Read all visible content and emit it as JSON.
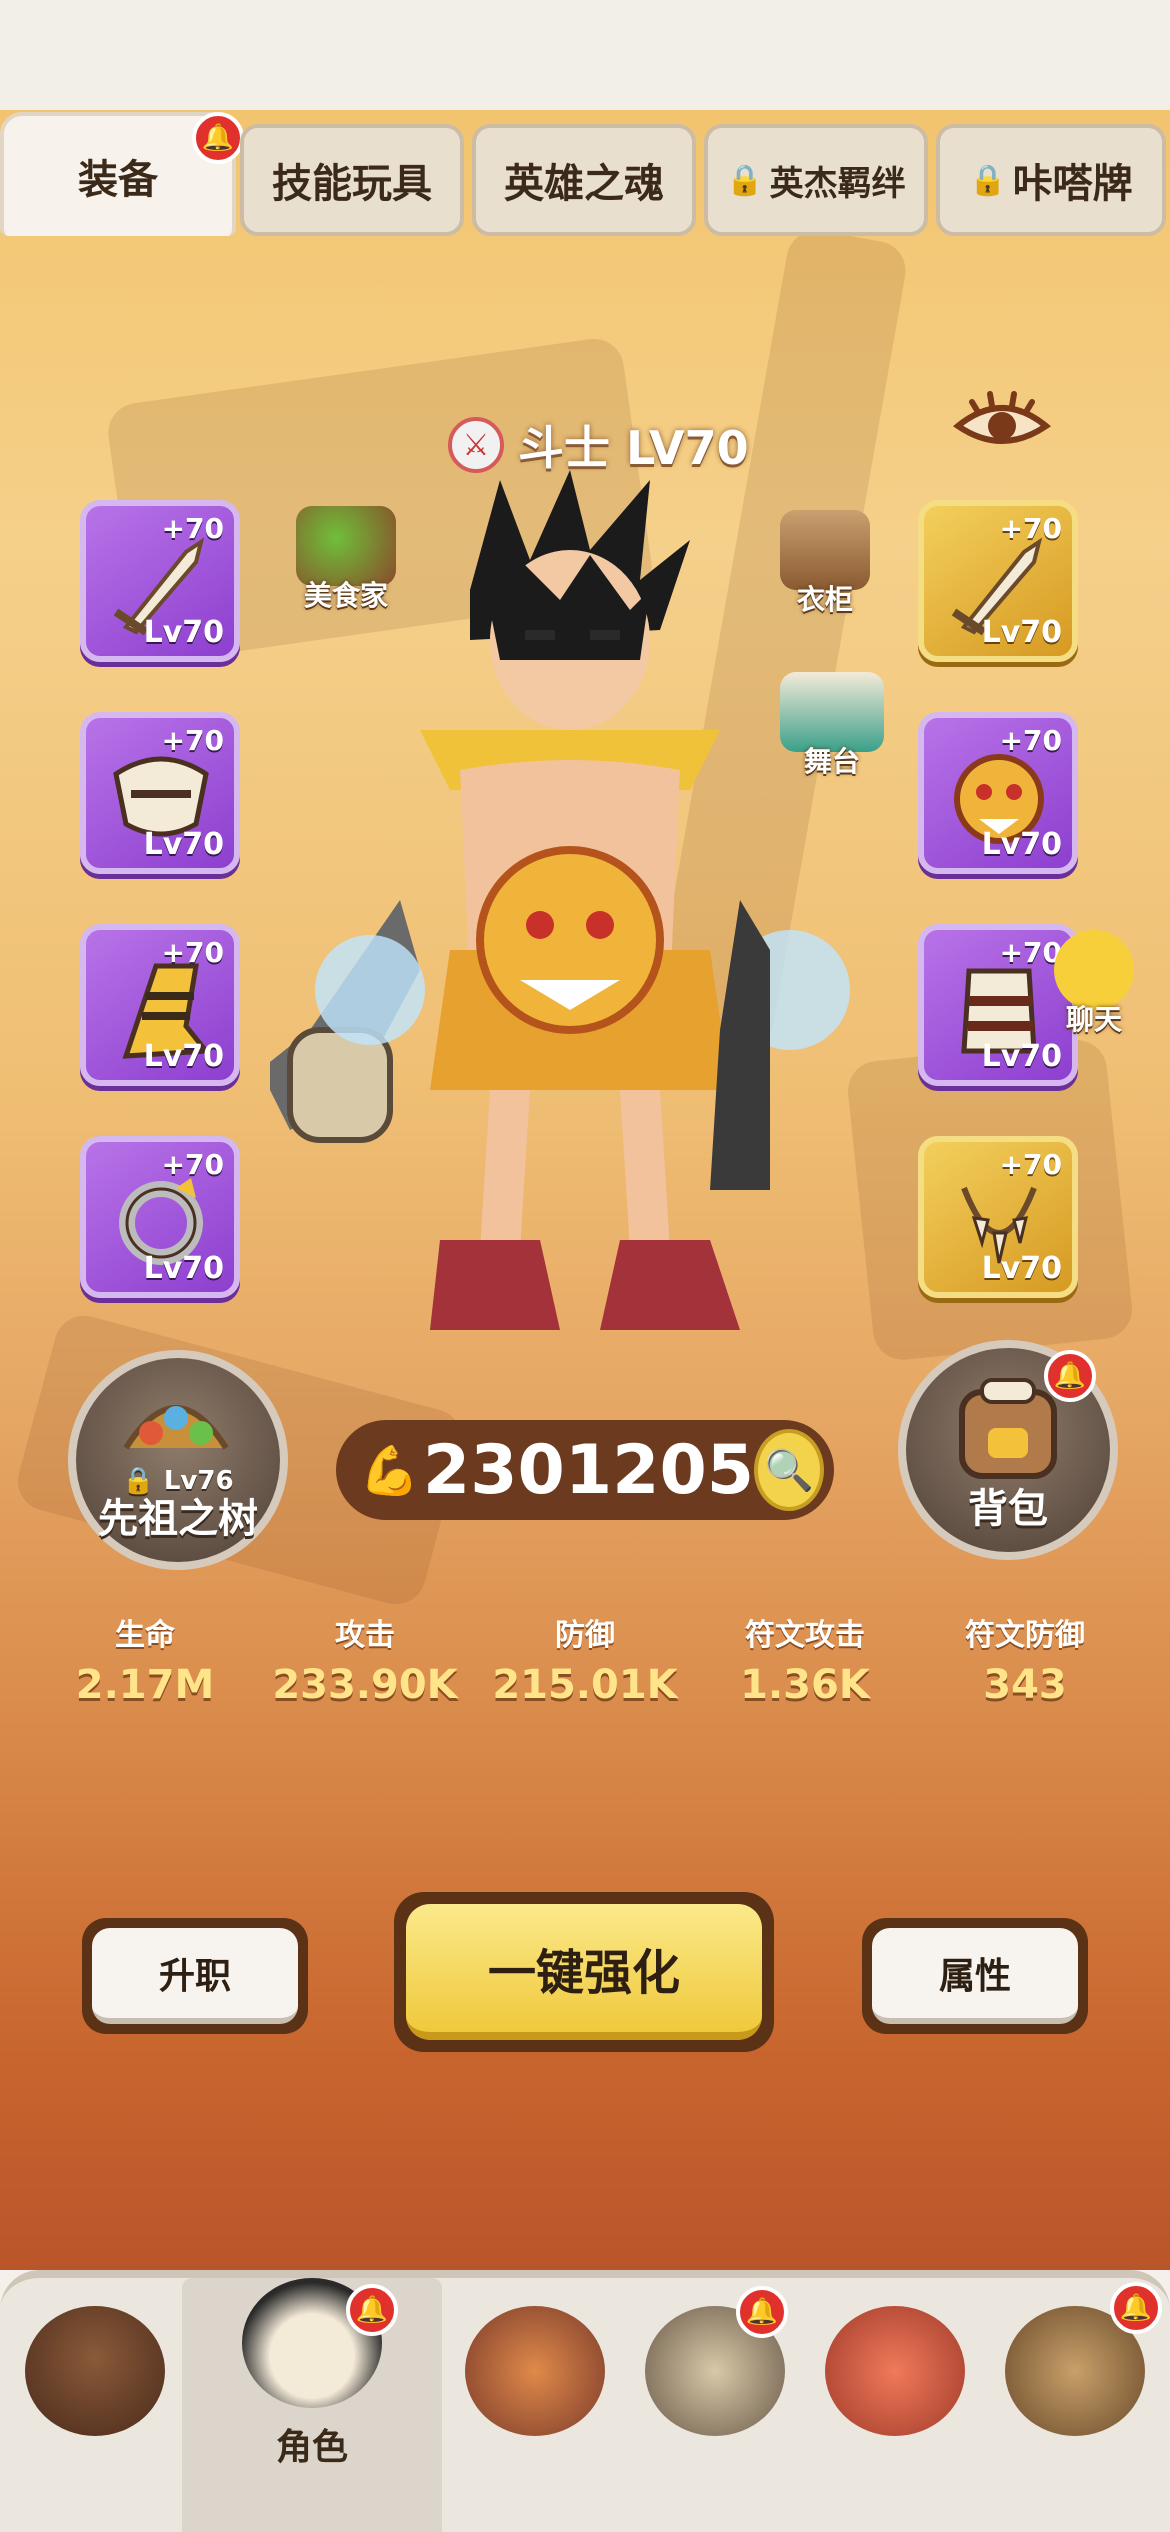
{
  "tabs": [
    {
      "label": "装备",
      "active": true,
      "locked": false,
      "badge": true
    },
    {
      "label": "技能玩具",
      "active": false,
      "locked": false,
      "badge": false
    },
    {
      "label": "英雄之魂",
      "active": false,
      "locked": false,
      "badge": false
    },
    {
      "label": "英杰羁绊",
      "active": false,
      "locked": true,
      "badge": false
    },
    {
      "label": "咔嗒牌",
      "active": false,
      "locked": true,
      "badge": false
    }
  ],
  "hero": {
    "class_icon": "crossed-swords-icon",
    "name": "斗士 LV70"
  },
  "equipment_left": [
    {
      "plus": "+70",
      "level": "Lv70",
      "rarity": "purple",
      "icon": "bone-sword-icon"
    },
    {
      "plus": "+70",
      "level": "Lv70",
      "rarity": "purple",
      "icon": "horn-helmet-icon"
    },
    {
      "plus": "+70",
      "level": "Lv70",
      "rarity": "purple",
      "icon": "fur-boot-icon"
    },
    {
      "plus": "+70",
      "level": "Lv70",
      "rarity": "purple",
      "icon": "bone-ring-icon"
    }
  ],
  "equipment_right": [
    {
      "plus": "+70",
      "level": "Lv70",
      "rarity": "gold",
      "icon": "bone-sword-icon"
    },
    {
      "plus": "+70",
      "level": "Lv70",
      "rarity": "purple",
      "icon": "tiger-armor-icon"
    },
    {
      "plus": "+70",
      "level": "Lv70",
      "rarity": "purple",
      "icon": "fur-glove-icon"
    },
    {
      "plus": "+70",
      "level": "Lv70",
      "rarity": "gold",
      "icon": "tooth-necklace-icon"
    }
  ],
  "mini_buttons": {
    "foodie": "美食家",
    "wardrobe": "衣柜",
    "stage": "舞台",
    "chat": "聊天"
  },
  "power": {
    "value": "2301205"
  },
  "ancestor_tree": {
    "label": "先祖之树",
    "level": "Lv76",
    "locked": true
  },
  "backpack": {
    "label": "背包",
    "badge": true
  },
  "stats": [
    {
      "key": "生命",
      "value": "2.17M"
    },
    {
      "key": "攻击",
      "value": "233.90K"
    },
    {
      "key": "防御",
      "value": "215.01K"
    },
    {
      "key": "符文攻击",
      "value": "1.36K"
    },
    {
      "key": "符文防御",
      "value": "343"
    }
  ],
  "actions": {
    "promote": "升职",
    "enhance_all": "一键强化",
    "attributes": "属性"
  },
  "nav": [
    {
      "label": "",
      "icon": "bear-home-icon",
      "badge": false,
      "active": false
    },
    {
      "label": "角色",
      "icon": "hero-skull-icon",
      "badge": true,
      "active": true
    },
    {
      "label": "",
      "icon": "totem-mask-icon",
      "badge": false,
      "active": false
    },
    {
      "label": "",
      "icon": "bearded-warrior-icon",
      "badge": true,
      "active": false
    },
    {
      "label": "",
      "icon": "dino-pet-icon",
      "badge": false,
      "active": false
    },
    {
      "label": "",
      "icon": "tribe-tent-icon",
      "badge": true,
      "active": false
    }
  ],
  "colors": {
    "purple": "#9c52d9",
    "gold": "#e6b13c",
    "accent_red": "#e0312c",
    "enhance_yellow": "#f0c93c"
  }
}
